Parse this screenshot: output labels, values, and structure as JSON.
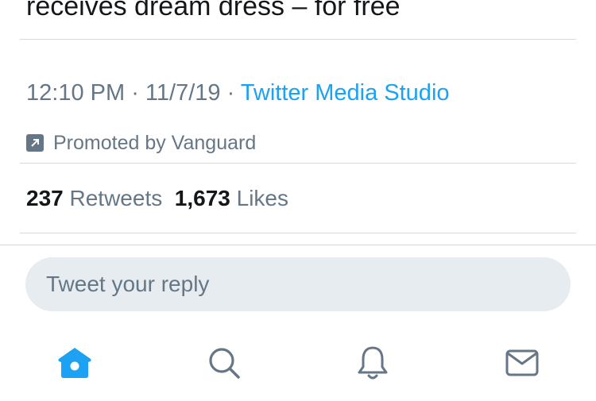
{
  "tweet": {
    "headline_tail": "receives dream dress – for free",
    "time": "12:10 PM",
    "separator": " · ",
    "date": "11/7/19",
    "source": "Twitter Media Studio",
    "promoted_label": "Promoted by Vanguard",
    "retweet_count": "237",
    "retweet_label": "Retweets",
    "like_count": "1,673",
    "like_label": "Likes"
  },
  "reply": {
    "placeholder": "Tweet your reply"
  },
  "tabbar": {
    "items": [
      {
        "icon": "home-icon",
        "active": true
      },
      {
        "icon": "search-icon",
        "active": false
      },
      {
        "icon": "bell-icon",
        "active": false
      },
      {
        "icon": "mail-icon",
        "active": false
      }
    ]
  },
  "colors": {
    "accent": "#1da1f2",
    "secondary_text": "#657786",
    "primary_text": "#14171a",
    "divider": "#d6d9dc",
    "reply_bg": "#e6ecf0"
  }
}
